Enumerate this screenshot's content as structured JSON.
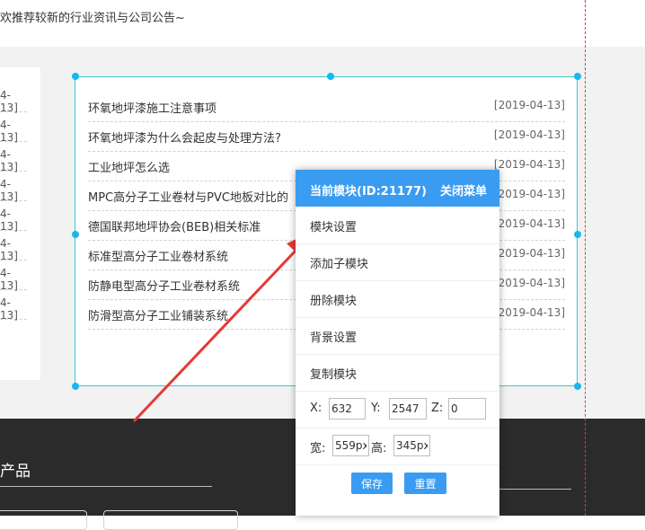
{
  "header": {
    "subtitle": "欢推荐较新的行业资讯与公司公告~"
  },
  "left_list": {
    "dates": [
      "4-13]",
      "4-13]",
      "4-13]",
      "4-13]",
      "4-13]",
      "4-13]",
      "4-13]",
      "4-13]"
    ]
  },
  "news": {
    "items": [
      {
        "title": "环氧地坪漆施工注意事项",
        "date": "[2019-04-13]"
      },
      {
        "title": "环氧地坪漆为什么会起皮与处理方法?",
        "date": "[2019-04-13]"
      },
      {
        "title": "工业地坪怎么选",
        "date": "[2019-04-13]"
      },
      {
        "title": "MPC高分子工业卷材与PVC地板对比的",
        "date": "2019-04-13]"
      },
      {
        "title": "德国联邦地坪协会(BEB)相关标准",
        "date": "2019-04-13]"
      },
      {
        "title": "标准型高分子工业卷材系统",
        "date": "2019-04-13]"
      },
      {
        "title": "防静电型高分子工业卷材系统",
        "date": "2019-04-13]"
      },
      {
        "title": "防滑型高分子工业铺装系统",
        "date": "2019-04-13]"
      }
    ]
  },
  "footer": {
    "title": "产品"
  },
  "context_menu": {
    "header_title": "当前模块(ID:21177)",
    "close_label": "关闭菜单",
    "items": [
      "模块设置",
      "添加子模块",
      "册除模块",
      "背景设置",
      "复制模块"
    ],
    "x_label": "X:",
    "x_value": "632",
    "y_label": "Y:",
    "y_value": "2547",
    "z_label": "Z:",
    "z_value": "0",
    "width_label": "宽:",
    "width_value": "559px",
    "height_label": "高:",
    "height_value": "345px",
    "save_label": "保存",
    "reset_label": "重置"
  },
  "colors": {
    "accent": "#3a9cf0",
    "selection_border": "#3cc6d6",
    "guide_line": "#e53935",
    "arrow": "#e53935",
    "footer_bg": "#2b2b2b"
  }
}
